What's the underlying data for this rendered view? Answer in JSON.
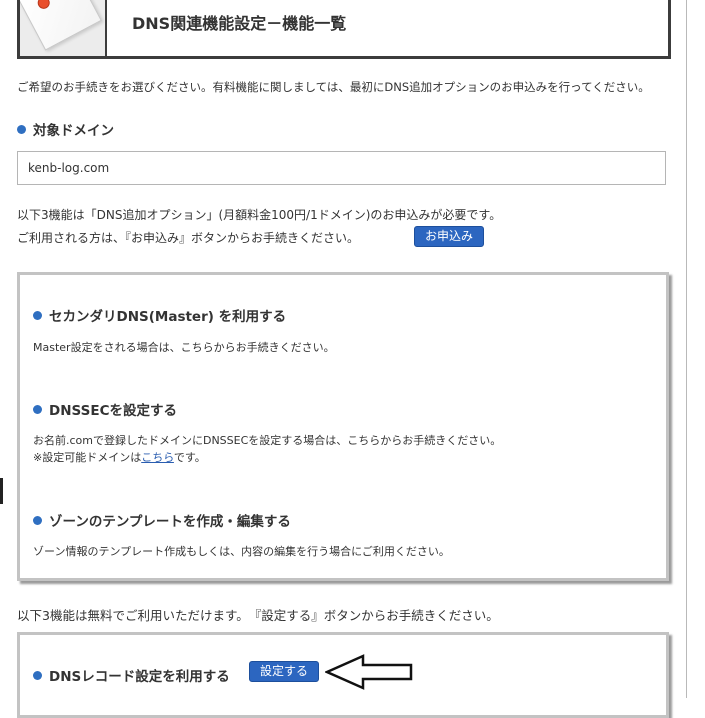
{
  "header": {
    "title": "DNS関連機能設定－機能一覧"
  },
  "intro_text": "ご希望のお手続きをお選びください。有料機能に関しましては、最初にDNS追加オプションのお申込みを行ってください。",
  "target_domain": {
    "heading": "対象ドメイン",
    "value": "kenb-log.com"
  },
  "paid_note": {
    "line1": "以下3機能は「DNS追加オプション」(月額料金100円/1ドメイン)のお申込みが必要です。",
    "line2": "ご利用される方は、『お申込み』ボタンからお手続きください。",
    "apply_label": "お申込み"
  },
  "paid_features": [
    {
      "heading": "セカンダリDNS(Master) を利用する",
      "desc1": "Master設定をされる場合は、こちらからお手続きください。"
    },
    {
      "heading": "DNSSECを設定する",
      "desc1": "お名前.comで登録したドメインにDNSSECを設定する場合は、こちらからお手続きください。",
      "desc2_prefix": "※設定可能ドメインは",
      "desc2_link": "こちら",
      "desc2_suffix": "です。"
    },
    {
      "heading": "ゾーンのテンプレートを作成・編集する",
      "desc1": "ゾーン情報のテンプレート作成もしくは、内容の編集を行う場合にご利用ください。"
    }
  ],
  "free_note": "以下3機能は無料でご利用いただけます。　『設定する』ボタンからお手続きください。",
  "free_features": [
    {
      "heading": "DNSレコード設定を利用する",
      "button_label": "設定する"
    }
  ],
  "colors": {
    "accent_blue": "#2c66c0",
    "bullet_blue": "#2f6fc1",
    "link_blue": "#2a5db0",
    "text": "#333333",
    "panel_border": "#c3c3c3",
    "header_border": "#3c3c3c"
  },
  "icons": {
    "header_thumbnail": "paper-document-icon",
    "bullet": "blue-dot-bullet-icon",
    "annotation": "left-arrow-outline-icon"
  }
}
